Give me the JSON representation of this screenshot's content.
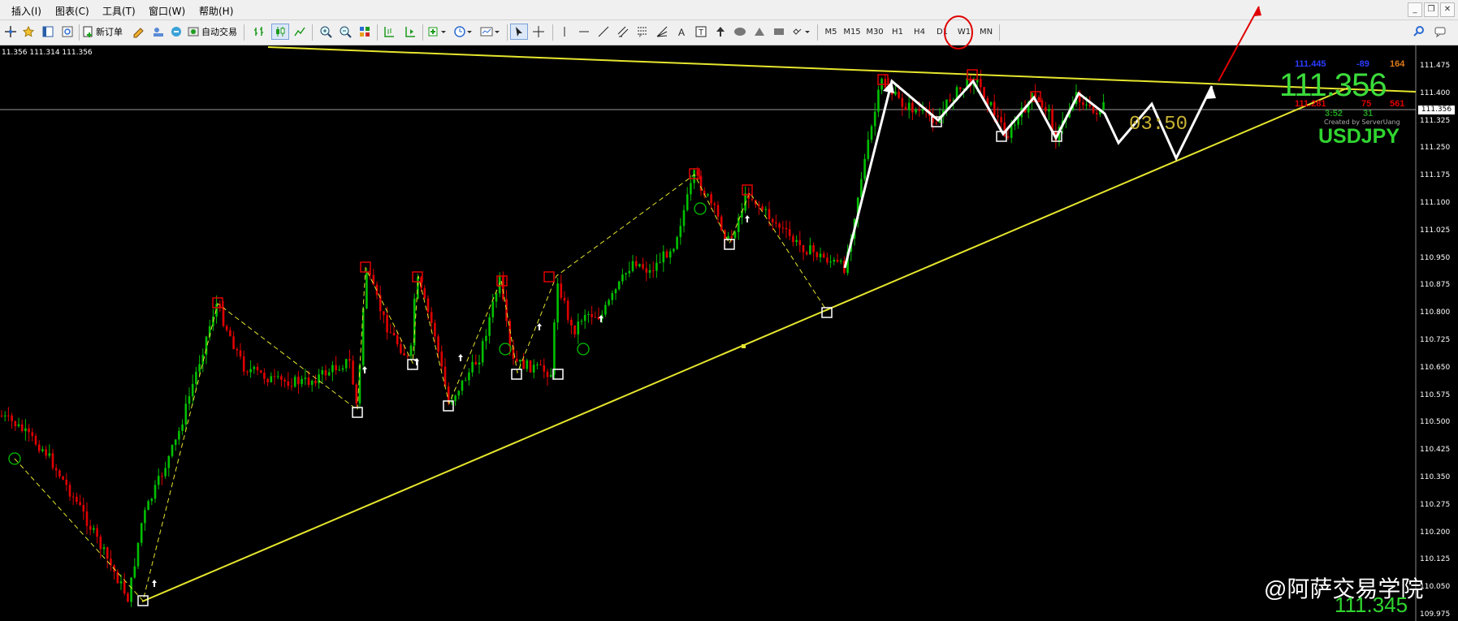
{
  "menu": {
    "items": [
      "插入(I)",
      "图表(C)",
      "工具(T)",
      "窗口(W)",
      "帮助(H)"
    ]
  },
  "toolbar": {
    "new_order_label": "新订单",
    "auto_trading_label": "自动交易",
    "timeframes": [
      "M5",
      "M15",
      "M30",
      "H1",
      "H4",
      "D1",
      "W1",
      "MN"
    ],
    "active_timeframe": "M15",
    "highlight_color": "#e00000"
  },
  "chart": {
    "symbol": "USDJPY",
    "quote_line": "11.356 111.314 111.356",
    "current_price_label": "111.356",
    "price_axis_labels": [
      "111.475",
      "111.400",
      "111.325",
      "111.250",
      "111.175",
      "111.100",
      "111.025",
      "110.950",
      "110.875",
      "110.800",
      "110.725",
      "110.650",
      "110.575",
      "110.500",
      "110.425",
      "110.350",
      "110.275",
      "110.200",
      "110.125",
      "110.050",
      "109.975"
    ],
    "timer": "03:50",
    "watermark": "@阿萨交易学院",
    "bottom_price": "111.345",
    "trendline_color": "#e6e62e",
    "bull_color": "#00c000",
    "bear_color": "#e00000",
    "panel": {
      "big_price": "111.356",
      "top_row": [
        "111.445",
        "-89",
        "164"
      ],
      "mid_row": [
        "111.281",
        "75",
        "561"
      ],
      "bottom_row": [
        "3:52",
        "31"
      ],
      "credit": "Created by ServerUang"
    }
  }
}
